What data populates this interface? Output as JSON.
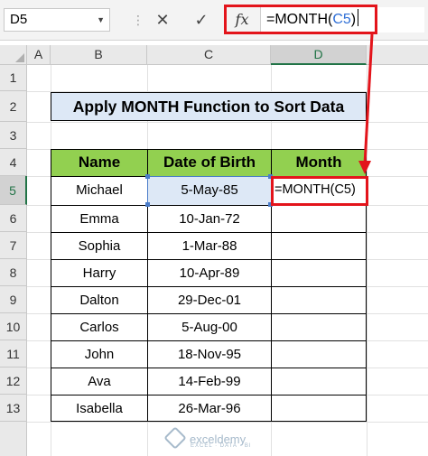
{
  "formula_bar": {
    "name_box": "D5",
    "cancel_icon": "✕",
    "enter_icon": "✓",
    "fx_label": "fx",
    "formula_prefix": "=MONTH(",
    "formula_ref": "C5",
    "formula_suffix": ")"
  },
  "columns": [
    "A",
    "B",
    "C",
    "D"
  ],
  "rows": [
    "1",
    "2",
    "3",
    "4",
    "5",
    "6",
    "7",
    "8",
    "9",
    "10",
    "11",
    "12",
    "13"
  ],
  "title": "Apply MONTH Function to Sort Data",
  "table": {
    "headers": [
      "Name",
      "Date of Birth",
      "Month"
    ],
    "rows": [
      [
        "Michael",
        "5-May-85",
        "=MONTH(C5)"
      ],
      [
        "Emma",
        "10-Jan-72",
        ""
      ],
      [
        "Sophia",
        "1-Mar-88",
        ""
      ],
      [
        "Harry",
        "10-Apr-89",
        ""
      ],
      [
        "Dalton",
        "29-Dec-01",
        ""
      ],
      [
        "Carlos",
        "5-Aug-00",
        ""
      ],
      [
        "John",
        "18-Nov-95",
        ""
      ],
      [
        "Ava",
        "14-Feb-99",
        ""
      ],
      [
        "Isabella",
        "26-Mar-96",
        ""
      ]
    ]
  },
  "watermark": {
    "name": "exceldemy",
    "tagline": "EXCEL · DATA · BI"
  },
  "colors": {
    "header_green": "#92d050",
    "title_blue": "#dde8f6",
    "highlight_red": "#e3141b",
    "excel_green": "#217346",
    "ref_blue": "#2f6fd6"
  }
}
